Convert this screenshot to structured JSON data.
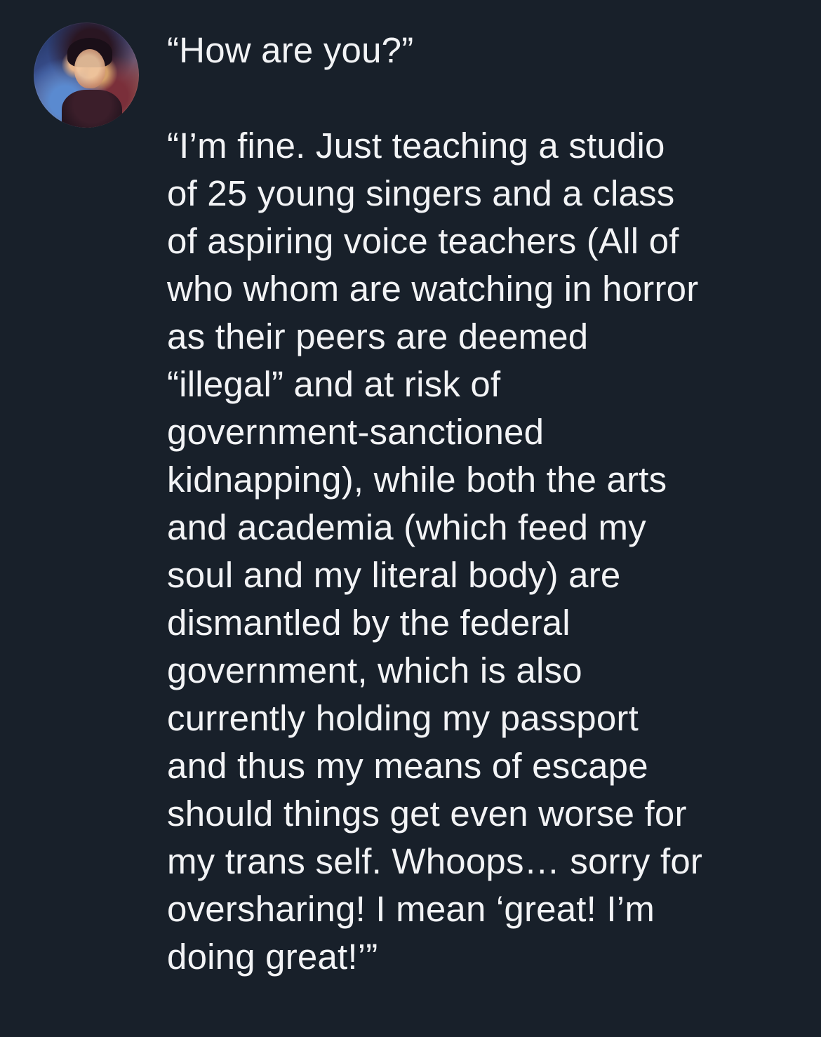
{
  "post": {
    "author_avatar": "avatar-photo",
    "text": "“How are you?”\n\n“I’m fine. Just teaching a studio\nof 25 young singers and a class\nof aspiring voice teachers (All of\nwho whom are watching in horror\nas their peers are deemed\n“illegal” and at risk of\ngovernment-sanctioned\nkidnapping), while both the arts\nand academia (which feed my\nsoul and my literal body) are\ndismantled by the federal\ngovernment, which is also\ncurrently holding my passport\nand thus my means of escape\nshould things get even worse for\nmy trans self. Whoops… sorry for\noversharing! I mean ‘great! I’m\ndoing great!’”"
  },
  "colors": {
    "background": "#18202a",
    "text": "#f2f3f5"
  }
}
